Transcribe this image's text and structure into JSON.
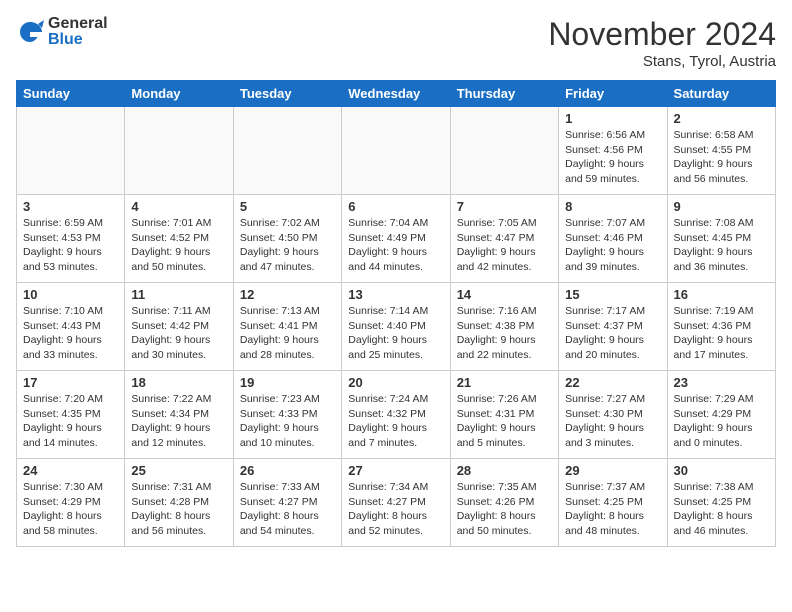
{
  "logo": {
    "general": "General",
    "blue": "Blue"
  },
  "title": "November 2024",
  "location": "Stans, Tyrol, Austria",
  "days": [
    "Sunday",
    "Monday",
    "Tuesday",
    "Wednesday",
    "Thursday",
    "Friday",
    "Saturday"
  ],
  "weeks": [
    [
      {
        "date": "",
        "info": ""
      },
      {
        "date": "",
        "info": ""
      },
      {
        "date": "",
        "info": ""
      },
      {
        "date": "",
        "info": ""
      },
      {
        "date": "",
        "info": ""
      },
      {
        "date": "1",
        "info": "Sunrise: 6:56 AM\nSunset: 4:56 PM\nDaylight: 9 hours\nand 59 minutes."
      },
      {
        "date": "2",
        "info": "Sunrise: 6:58 AM\nSunset: 4:55 PM\nDaylight: 9 hours\nand 56 minutes."
      }
    ],
    [
      {
        "date": "3",
        "info": "Sunrise: 6:59 AM\nSunset: 4:53 PM\nDaylight: 9 hours\nand 53 minutes."
      },
      {
        "date": "4",
        "info": "Sunrise: 7:01 AM\nSunset: 4:52 PM\nDaylight: 9 hours\nand 50 minutes."
      },
      {
        "date": "5",
        "info": "Sunrise: 7:02 AM\nSunset: 4:50 PM\nDaylight: 9 hours\nand 47 minutes."
      },
      {
        "date": "6",
        "info": "Sunrise: 7:04 AM\nSunset: 4:49 PM\nDaylight: 9 hours\nand 44 minutes."
      },
      {
        "date": "7",
        "info": "Sunrise: 7:05 AM\nSunset: 4:47 PM\nDaylight: 9 hours\nand 42 minutes."
      },
      {
        "date": "8",
        "info": "Sunrise: 7:07 AM\nSunset: 4:46 PM\nDaylight: 9 hours\nand 39 minutes."
      },
      {
        "date": "9",
        "info": "Sunrise: 7:08 AM\nSunset: 4:45 PM\nDaylight: 9 hours\nand 36 minutes."
      }
    ],
    [
      {
        "date": "10",
        "info": "Sunrise: 7:10 AM\nSunset: 4:43 PM\nDaylight: 9 hours\nand 33 minutes."
      },
      {
        "date": "11",
        "info": "Sunrise: 7:11 AM\nSunset: 4:42 PM\nDaylight: 9 hours\nand 30 minutes."
      },
      {
        "date": "12",
        "info": "Sunrise: 7:13 AM\nSunset: 4:41 PM\nDaylight: 9 hours\nand 28 minutes."
      },
      {
        "date": "13",
        "info": "Sunrise: 7:14 AM\nSunset: 4:40 PM\nDaylight: 9 hours\nand 25 minutes."
      },
      {
        "date": "14",
        "info": "Sunrise: 7:16 AM\nSunset: 4:38 PM\nDaylight: 9 hours\nand 22 minutes."
      },
      {
        "date": "15",
        "info": "Sunrise: 7:17 AM\nSunset: 4:37 PM\nDaylight: 9 hours\nand 20 minutes."
      },
      {
        "date": "16",
        "info": "Sunrise: 7:19 AM\nSunset: 4:36 PM\nDaylight: 9 hours\nand 17 minutes."
      }
    ],
    [
      {
        "date": "17",
        "info": "Sunrise: 7:20 AM\nSunset: 4:35 PM\nDaylight: 9 hours\nand 14 minutes."
      },
      {
        "date": "18",
        "info": "Sunrise: 7:22 AM\nSunset: 4:34 PM\nDaylight: 9 hours\nand 12 minutes."
      },
      {
        "date": "19",
        "info": "Sunrise: 7:23 AM\nSunset: 4:33 PM\nDaylight: 9 hours\nand 10 minutes."
      },
      {
        "date": "20",
        "info": "Sunrise: 7:24 AM\nSunset: 4:32 PM\nDaylight: 9 hours\nand 7 minutes."
      },
      {
        "date": "21",
        "info": "Sunrise: 7:26 AM\nSunset: 4:31 PM\nDaylight: 9 hours\nand 5 minutes."
      },
      {
        "date": "22",
        "info": "Sunrise: 7:27 AM\nSunset: 4:30 PM\nDaylight: 9 hours\nand 3 minutes."
      },
      {
        "date": "23",
        "info": "Sunrise: 7:29 AM\nSunset: 4:29 PM\nDaylight: 9 hours\nand 0 minutes."
      }
    ],
    [
      {
        "date": "24",
        "info": "Sunrise: 7:30 AM\nSunset: 4:29 PM\nDaylight: 8 hours\nand 58 minutes."
      },
      {
        "date": "25",
        "info": "Sunrise: 7:31 AM\nSunset: 4:28 PM\nDaylight: 8 hours\nand 56 minutes."
      },
      {
        "date": "26",
        "info": "Sunrise: 7:33 AM\nSunset: 4:27 PM\nDaylight: 8 hours\nand 54 minutes."
      },
      {
        "date": "27",
        "info": "Sunrise: 7:34 AM\nSunset: 4:27 PM\nDaylight: 8 hours\nand 52 minutes."
      },
      {
        "date": "28",
        "info": "Sunrise: 7:35 AM\nSunset: 4:26 PM\nDaylight: 8 hours\nand 50 minutes."
      },
      {
        "date": "29",
        "info": "Sunrise: 7:37 AM\nSunset: 4:25 PM\nDaylight: 8 hours\nand 48 minutes."
      },
      {
        "date": "30",
        "info": "Sunrise: 7:38 AM\nSunset: 4:25 PM\nDaylight: 8 hours\nand 46 minutes."
      }
    ]
  ]
}
